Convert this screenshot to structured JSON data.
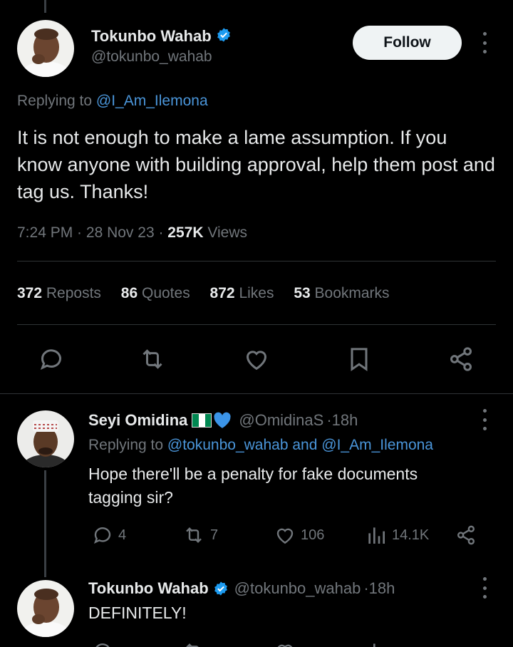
{
  "main_tweet": {
    "author_name": "Tokunbo Wahab",
    "handle": "@tokunbo_wahab",
    "follow_label": "Follow",
    "replying_prefix": "Replying to",
    "replying_to": "@I_Am_Ilemona",
    "text": "It is not enough to make a lame assumption. If you know anyone with building approval, help them post and tag us. Thanks!",
    "time": "7:24 PM",
    "date": "28 Nov 23",
    "views_count": "257K",
    "views_label": "Views",
    "stats": [
      {
        "count": "372",
        "label": "Reposts"
      },
      {
        "count": "86",
        "label": "Quotes"
      },
      {
        "count": "872",
        "label": "Likes"
      },
      {
        "count": "53",
        "label": "Bookmarks"
      }
    ]
  },
  "reply1": {
    "author_name": "Seyi Omidina",
    "handle": "@OmidinaS",
    "age": "18h",
    "replying_prefix": "Replying to",
    "replying_to_a": "@tokunbo_wahab",
    "and": "and",
    "replying_to_b": "@I_Am_Ilemona",
    "text": "Hope there'll be a penalty for fake documents tagging sir?",
    "replies": "4",
    "reposts": "7",
    "likes": "106",
    "views": "14.1K"
  },
  "reply2": {
    "author_name": "Tokunbo Wahab",
    "handle": "@tokunbo_wahab",
    "age": "18h",
    "text": "DEFINITELY!"
  },
  "colors": {
    "background": "#000000",
    "text": "#e7e9ea",
    "muted": "#71767b",
    "link": "#4a95d9",
    "verified": "#1d9bf0"
  }
}
